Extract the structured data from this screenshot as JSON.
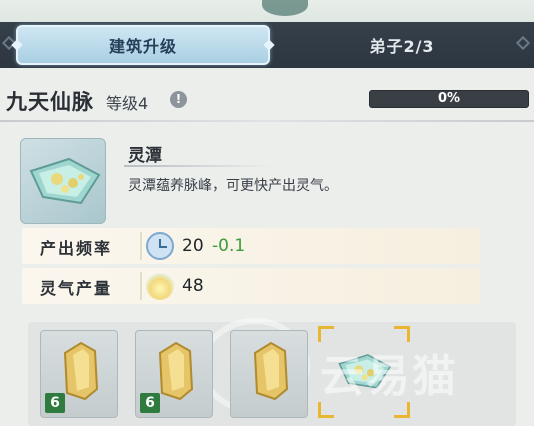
{
  "tabs": [
    {
      "label": "建筑升级",
      "active": true
    },
    {
      "label": "弟子2/3",
      "active": false
    }
  ],
  "header": {
    "title": "九天仙脉",
    "level": "等级4",
    "progress_text": "0%",
    "progress": 0
  },
  "building": {
    "name": "灵潭",
    "description": "灵潭蕴养脉峰，可更快产出灵气。",
    "icon": "spirit-pool-crystal"
  },
  "stats": [
    {
      "label": "产出频率",
      "icon": "clock-icon",
      "value": "20",
      "delta": "-0.1"
    },
    {
      "label": "灵气产量",
      "icon": "spirit-flame-icon",
      "value": "48",
      "delta": ""
    }
  ],
  "materials": [
    {
      "icon": "gold-crystal",
      "count": "6"
    },
    {
      "icon": "gold-crystal",
      "count": "6"
    },
    {
      "icon": "gold-crystal",
      "count": ""
    },
    {
      "icon": "spirit-pool-crystal",
      "count": "",
      "selected": true
    }
  ],
  "watermark": "云易猫",
  "colors": {
    "tab_active": "#a9cfe3",
    "tab_bar": "#2d3640",
    "delta_green": "#3d9a3a",
    "selection_gold": "#e8b630",
    "badge_green": "#2f7a3e"
  }
}
